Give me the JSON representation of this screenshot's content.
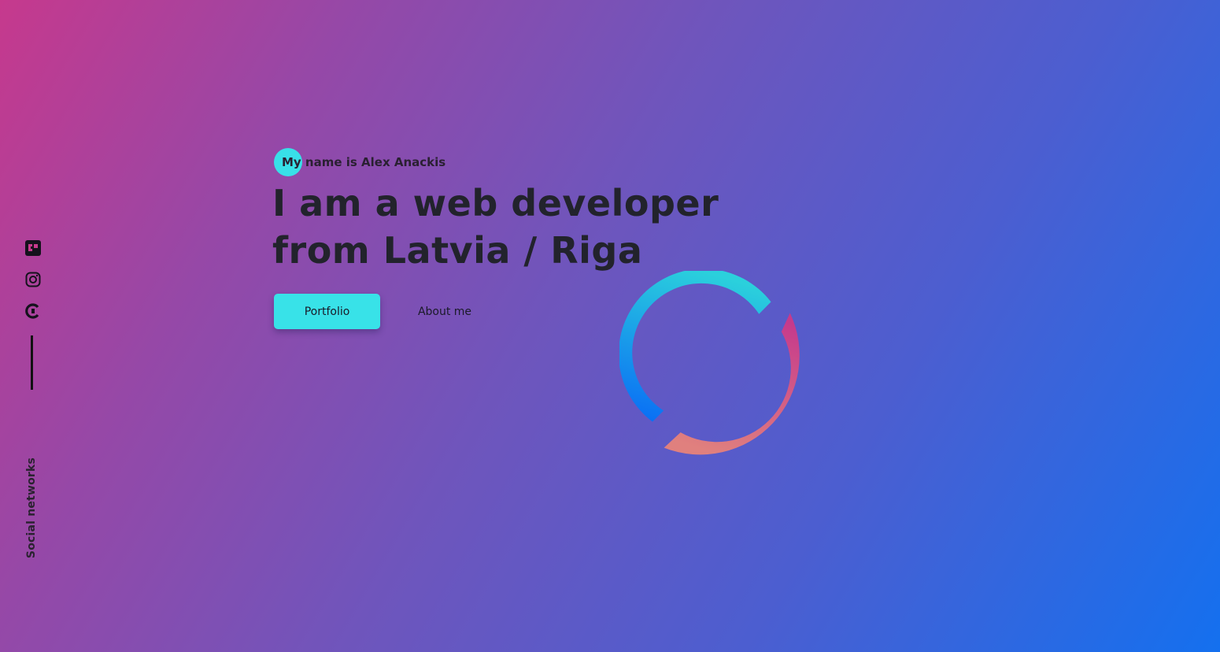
{
  "colors": {
    "background_start": "#c6398d",
    "background_end": "#1470ef",
    "accent": "#38e2e8",
    "text": "#22232c"
  },
  "social": {
    "icons": [
      "flickr-icon",
      "instagram-icon",
      "codepen-icon"
    ],
    "label": "Social networks"
  },
  "hero": {
    "intro": "My name is Alex Anackis",
    "headline": "I am a web developer from Latvia / Riga"
  },
  "buttons": {
    "portfolio": "Portfolio",
    "about": "About me"
  }
}
